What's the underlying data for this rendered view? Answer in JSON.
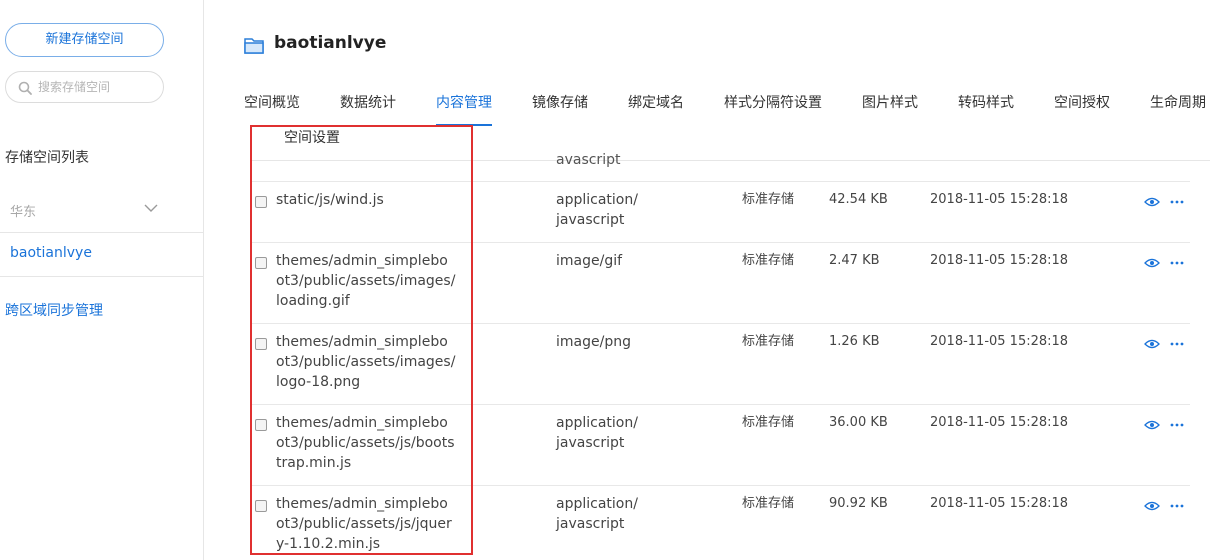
{
  "sidebar": {
    "new_button": "新建存储空间",
    "search_placeholder": "搜索存储空间",
    "list_title": "存储空间列表",
    "region": "华东",
    "bucket": "baotianlvye",
    "sync_link": "跨区域同步管理"
  },
  "header": {
    "title": "baotianlvye",
    "tabs": [
      "空间概览",
      "数据统计",
      "内容管理",
      "镜像存储",
      "绑定域名",
      "样式分隔符设置",
      "图片样式",
      "转码样式",
      "空间授权",
      "生命周期"
    ],
    "tab_second_line": "空间设置",
    "active_tab": "内容管理"
  },
  "table": {
    "partial_text": "avascript",
    "rows": [
      {
        "path": "static/js/wind.js",
        "mime": "application/javascript",
        "storage": "标准存储",
        "size": "42.54 KB",
        "date": "2018-11-05 15:28:18"
      },
      {
        "path": "themes/admin_simpleboot3/public/assets/images/loading.gif",
        "mime": "image/gif",
        "storage": "标准存储",
        "size": "2.47 KB",
        "date": "2018-11-05 15:28:18"
      },
      {
        "path": "themes/admin_simpleboot3/public/assets/images/logo-18.png",
        "mime": "image/png",
        "storage": "标准存储",
        "size": "1.26 KB",
        "date": "2018-11-05 15:28:18"
      },
      {
        "path": "themes/admin_simpleboot3/public/assets/js/bootstrap.min.js",
        "mime": "application/javascript",
        "storage": "标准存储",
        "size": "36.00 KB",
        "date": "2018-11-05 15:28:18"
      },
      {
        "path": "themes/admin_simpleboot3/public/assets/js/jquery-1.10.2.min.js",
        "mime": "application/javascript",
        "storage": "标准存储",
        "size": "90.92 KB",
        "date": "2018-11-05 15:28:18"
      }
    ]
  },
  "colors": {
    "accent": "#1a73d9",
    "highlight": "#e03030"
  }
}
